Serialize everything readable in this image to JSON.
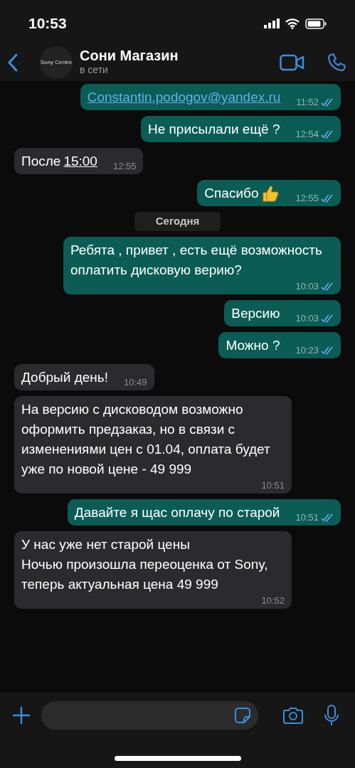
{
  "status_bar": {
    "time": "10:53"
  },
  "header": {
    "avatar_text": "Sony Centre",
    "name": "Сони Магазин",
    "status": "в сети"
  },
  "messages": [
    {
      "kind": "out",
      "link": "Constantin.podogov@yandex.ru",
      "time": "11:52",
      "read": true
    },
    {
      "kind": "out",
      "text": "Не присылали ещё ?",
      "time": "12:54",
      "read": true
    },
    {
      "kind": "in",
      "text": "После ",
      "link": "15:00",
      "time": "12:55"
    },
    {
      "kind": "out",
      "text": "Спасибо",
      "emoji": true,
      "time": "12:55",
      "read": true
    },
    {
      "kind": "date",
      "text": "Сегодня"
    },
    {
      "kind": "out",
      "text": "Ребята , привет , есть ещё возможность оплатить дисковую верию?",
      "time": "10:03",
      "read": true
    },
    {
      "kind": "out",
      "text": "Версию",
      "time": "10:03",
      "read": true
    },
    {
      "kind": "out",
      "text": "Можно ?",
      "time": "10:23",
      "read": true
    },
    {
      "kind": "in",
      "text": "Добрый день!",
      "time": "10:49"
    },
    {
      "kind": "in",
      "text": "На версию с дисководом возможно оформить предзаказ, но в связи с изменениями цен с 01.04, оплата будет уже по новой цене - 49 999",
      "time": "10:51"
    },
    {
      "kind": "out",
      "text": "Давайте я щас оплачу по старой",
      "time": "10:51",
      "read": true
    },
    {
      "kind": "in",
      "text": "У нас уже нет старой цены\nНочью произошла переоценка от Sony, теперь актуальная цена 49 999",
      "time": "10:52"
    }
  ]
}
